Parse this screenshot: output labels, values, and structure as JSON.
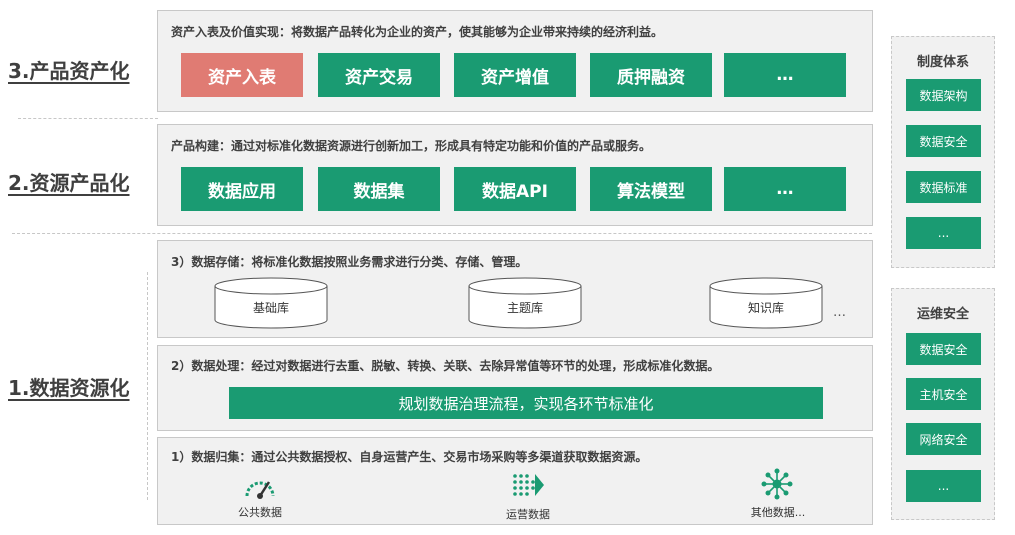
{
  "levels": {
    "asset": "3.产品资产化",
    "product": "2.资源产品化",
    "data": "1.数据资源化"
  },
  "asset_panel": {
    "desc": "资产入表及价值实现：将数据产品转化为企业的资产，使其能够为企业带来持续的经济利益。",
    "buttons": [
      "资产入表",
      "资产交易",
      "资产增值",
      "质押融资",
      "…"
    ]
  },
  "product_panel": {
    "desc": "产品构建：通过对标准化数据资源进行创新加工，形成具有特定功能和价值的产品或服务。",
    "buttons": [
      "数据应用",
      "数据集",
      "数据API",
      "算法模型",
      "…"
    ]
  },
  "storage_panel": {
    "desc": "3）数据存储：将标准化数据按照业务需求进行分类、存储、管理。",
    "stores": [
      "基础库",
      "主题库",
      "知识库"
    ],
    "more": "…"
  },
  "processing_panel": {
    "desc": "2）数据处理：经过对数据进行去重、脱敏、转换、关联、去除异常值等环节的处理，形成标准化数据。",
    "bar": "规划数据治理流程，实现各环节标准化"
  },
  "collection_panel": {
    "desc": "1）数据归集：通过公共数据授权、自身运营产生、交易市场采购等多渠道获取数据资源。",
    "sources": [
      "公共数据",
      "运营数据",
      "其他数据..."
    ]
  },
  "system_panel": {
    "title": "制度体系",
    "items": [
      "数据架构",
      "数据安全",
      "数据标准",
      "..."
    ]
  },
  "ops_panel": {
    "title": "运维安全",
    "items": [
      "数据安全",
      "主机安全",
      "网络安全",
      "..."
    ]
  },
  "colors": {
    "green": "#1a9b72",
    "highlight": "#e07b73",
    "panel_bg": "#f1f1f1"
  },
  "icons": [
    "gauge-icon",
    "arrow-grid-icon",
    "network-icon",
    "database-cylinder-icon"
  ]
}
